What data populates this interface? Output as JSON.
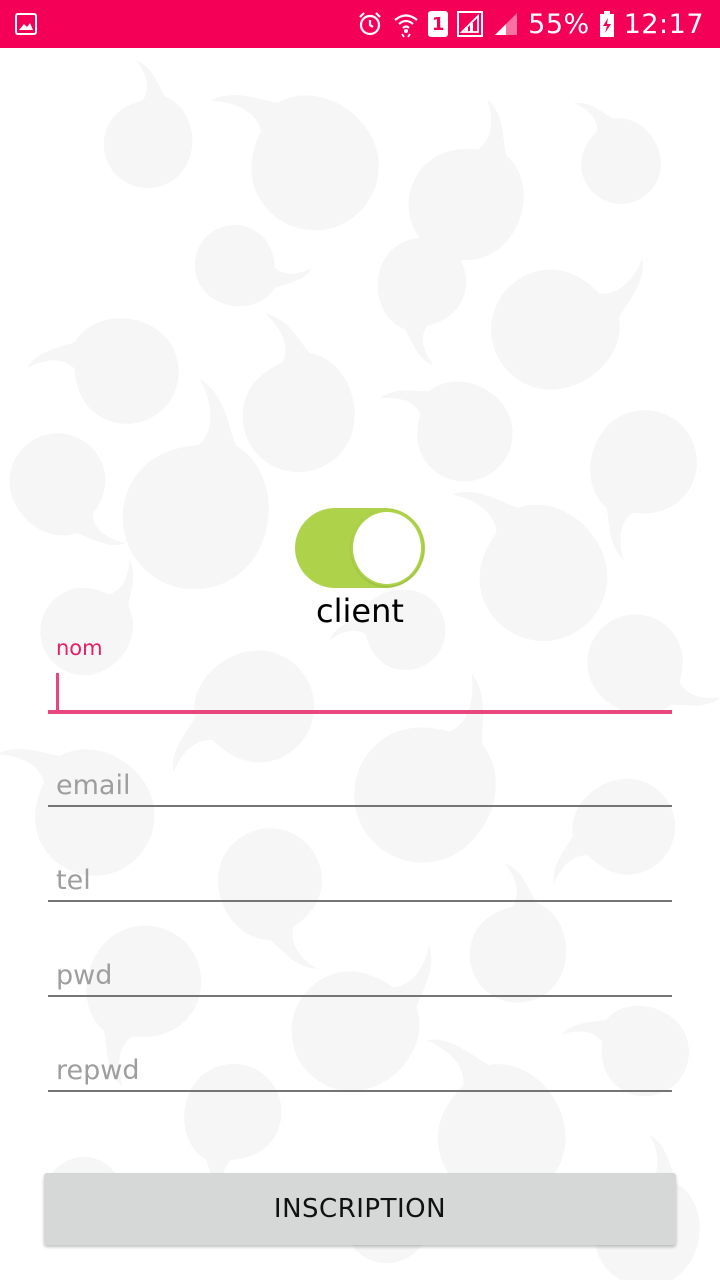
{
  "status_bar": {
    "battery": "55%",
    "time": "12:17",
    "sim_slot": "1",
    "background_color": "#F50057",
    "icons": [
      "gallery-icon",
      "alarm-icon",
      "wifi-icon",
      "sim-icon",
      "signal-icon",
      "signal-2-icon",
      "battery-charging-icon"
    ]
  },
  "toggle": {
    "checked": true,
    "label": "client",
    "color": "#AED34A"
  },
  "form": {
    "nom": {
      "label": "nom",
      "value": ""
    },
    "email": {
      "placeholder": "email"
    },
    "tel": {
      "placeholder": "tel"
    },
    "pwd": {
      "placeholder": "pwd"
    },
    "repwd": {
      "placeholder": "repwd"
    },
    "accent_color": "#E8467C"
  },
  "button": {
    "label": "INSCRIPTION"
  }
}
